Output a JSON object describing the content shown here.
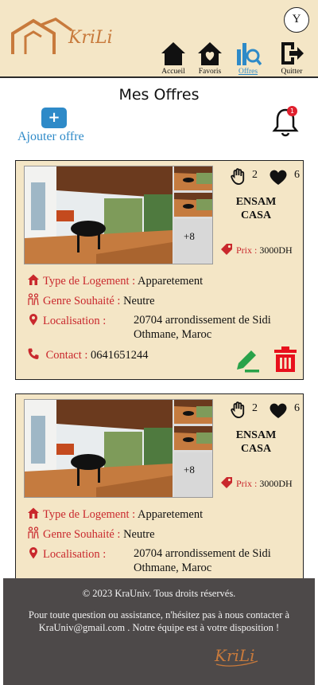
{
  "header": {
    "logo_text": "KriLi",
    "avatar_initial": "Y",
    "nav": [
      {
        "label": "Accueil",
        "icon": "home-icon"
      },
      {
        "label": "Favoris",
        "icon": "heart-house-icon"
      },
      {
        "label": "Offres",
        "icon": "offers-search-icon",
        "active": true
      },
      {
        "label": "Quitter",
        "icon": "logout-icon"
      }
    ]
  },
  "page": {
    "title": "Mes Offres",
    "add_button_symbol": "+",
    "add_label": "Ajouter offre",
    "notification_count": "1"
  },
  "offers": [
    {
      "thumb_more": "+8",
      "likes": "2",
      "favorites": "6",
      "school_line1": "ENSAM",
      "school_line2": "CASA",
      "price_label": "Prix : ",
      "price_value": "3000DH",
      "type_label": "Type de Logement",
      "type_value": "Apparetement",
      "gender_label": "Genre Souhaité",
      "gender_value": "Neutre",
      "location_label": "Localisation",
      "location_value": "20704 arrondissement de Sidi Othmane, Maroc",
      "contact_label": "Contact",
      "contact_value": "0641651244"
    },
    {
      "thumb_more": "+8",
      "likes": "2",
      "favorites": "6",
      "school_line1": "ENSAM",
      "school_line2": "CASA",
      "price_label": "Prix : ",
      "price_value": "3000DH",
      "type_label": "Type de Logement",
      "type_value": "Apparetement",
      "gender_label": "Genre Souhaité",
      "gender_value": "Neutre",
      "location_label": "Localisation",
      "location_value": "20704 arrondissement de Sidi Othmane, Maroc"
    }
  ],
  "footer": {
    "copyright": "© 2023 KraUniv. Tous droits réservés.",
    "contact": "Pour toute question ou assistance, n'hésitez pas à nous contacter à KraUniv@gmail.com . Notre équipe est à votre disposition !",
    "logo_text": "KriLi"
  },
  "colors": {
    "cream": "#f4e6c6",
    "accent_blue": "#2e8ac8",
    "label_red": "#c9282d",
    "edit_green": "#2aa24a",
    "delete_red": "#e8101c",
    "brand_orange": "#c87a3c",
    "footer_gray": "#4d4949"
  }
}
